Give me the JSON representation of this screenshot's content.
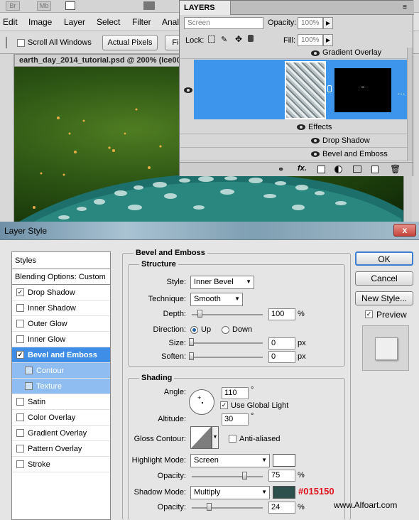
{
  "appbar": {
    "br": "Br",
    "mb": "Mb"
  },
  "menu": [
    "Edit",
    "Image",
    "Layer",
    "Select",
    "Filter",
    "Anal"
  ],
  "options": {
    "scroll_all_windows": "Scroll All Windows",
    "actual_pixels": "Actual Pixels",
    "fit": "Fi"
  },
  "document": {
    "tab": "earth_day_2014_tutorial.psd @ 200% (Ice00"
  },
  "layers": {
    "title": "LAYERS",
    "blend_mode": "Screen",
    "opacity_label": "Opacity:",
    "opacity_value": "100%",
    "lock_label": "Lock:",
    "fill_label": "Fill:",
    "fill_value": "100%",
    "gradient_overlay": "Gradient Overlay",
    "effects": "Effects",
    "drop_shadow": "Drop Shadow",
    "bevel_emboss": "Bevel and Emboss",
    "fx": "fx."
  },
  "dialog": {
    "title": "Layer Style",
    "close": "x",
    "styles_header": "Styles",
    "blending": "Blending Options: Custom",
    "items": [
      {
        "label": "Drop Shadow",
        "checked": true
      },
      {
        "label": "Inner Shadow",
        "checked": false
      },
      {
        "label": "Outer Glow",
        "checked": false
      },
      {
        "label": "Inner Glow",
        "checked": false
      },
      {
        "label": "Bevel and Emboss",
        "checked": true
      },
      {
        "label": "Contour",
        "checked": false
      },
      {
        "label": "Texture",
        "checked": false
      },
      {
        "label": "Satin",
        "checked": false
      },
      {
        "label": "Color Overlay",
        "checked": false
      },
      {
        "label": "Gradient Overlay",
        "checked": false
      },
      {
        "label": "Pattern Overlay",
        "checked": false
      },
      {
        "label": "Stroke",
        "checked": false
      }
    ],
    "buttons": {
      "ok": "OK",
      "cancel": "Cancel",
      "new_style": "New Style...",
      "preview": "Preview"
    },
    "bevel": {
      "section_title": "Bevel and Emboss",
      "structure": "Structure",
      "style_label": "Style:",
      "style_value": "Inner Bevel",
      "technique_label": "Technique:",
      "technique_value": "Smooth",
      "depth_label": "Depth:",
      "depth_value": "100",
      "depth_unit": "%",
      "depth_level": 0.1,
      "direction_label": "Direction:",
      "up": "Up",
      "down": "Down",
      "size_label": "Size:",
      "size_value": "0",
      "size_unit": "px",
      "soften_label": "Soften:",
      "soften_value": "0",
      "soften_unit": "px"
    },
    "shading": {
      "title": "Shading",
      "angle_label": "Angle:",
      "angle_value": "110",
      "angle_unit": "°",
      "use_global_light": "Use Global Light",
      "altitude_label": "Altitude:",
      "altitude_value": "30",
      "altitude_unit": "°",
      "gloss_contour_label": "Gloss Contour:",
      "anti_aliased": "Anti-aliased",
      "highlight_mode_label": "Highlight Mode:",
      "highlight_mode": "Screen",
      "highlight_opacity_label": "Opacity:",
      "highlight_opacity": "75",
      "highlight_unit": "%",
      "shadow_mode_label": "Shadow Mode:",
      "shadow_mode": "Multiply",
      "shadow_opacity_label": "Opacity:",
      "shadow_opacity": "24",
      "shadow_unit": "%",
      "shadow_color_code": "#015150"
    }
  },
  "watermark": "www.Alfoart.com",
  "colors": {
    "selection_blue": "#3e8ee8",
    "shadow_swatch": "#2e504d",
    "shadow_code_red": "#e0141e"
  }
}
